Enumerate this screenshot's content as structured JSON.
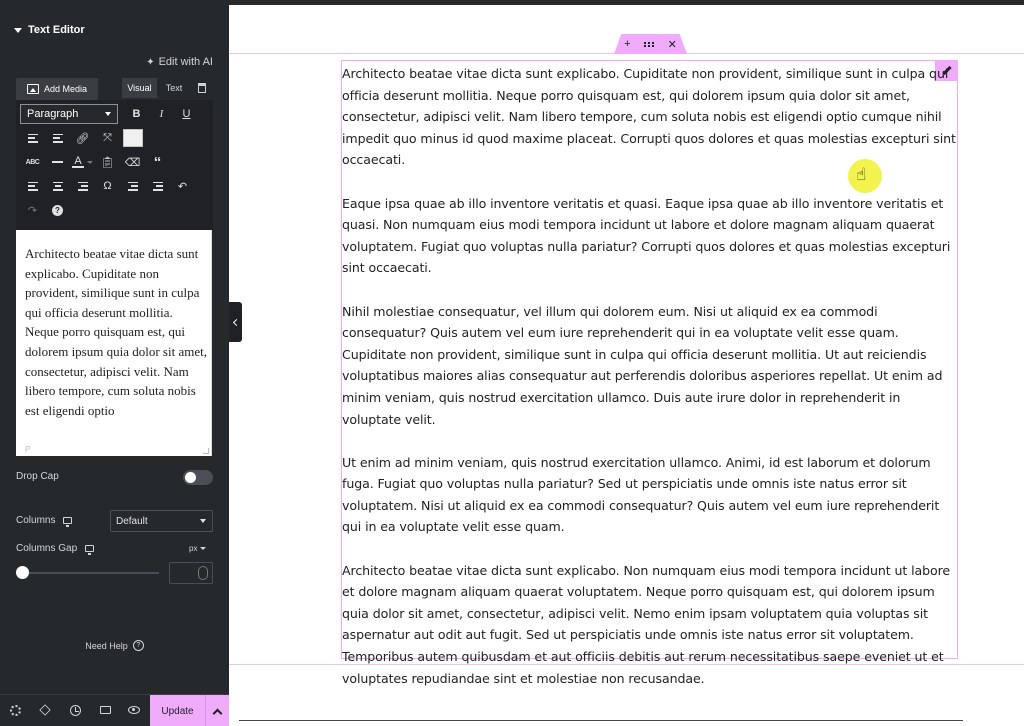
{
  "panel": {
    "title": "Text Editor",
    "edit_ai_label": "Edit with AI",
    "editor_toolbar": {
      "add_media_label": "Add Media",
      "tabs": [
        "Visual",
        "Text"
      ],
      "format_select_value": "Paragraph"
    },
    "editor_content": "Architecto beatae vitae dicta sunt explicabo. Cupiditate non provident, similique sunt in culpa qui officia deserunt mollitia. Neque porro quisquam est, qui dolorem ipsum quia dolor sit amet, consectetur, adipisci velit. Nam libero tempore, cum soluta nobis est eligendi optio",
    "editor_path": "P",
    "drop_cap_label": "Drop Cap",
    "columns_label": "Columns",
    "columns_value": "Default",
    "columns_gap_label": "Columns Gap",
    "columns_gap_unit": "px",
    "need_help_label": "Need Help",
    "update_label": "Update"
  },
  "widget": {
    "paragraphs": [
      "Architecto beatae vitae dicta sunt explicabo. Cupiditate non provident, similique sunt in culpa qui officia deserunt mollitia. Neque porro quisquam est, qui dolorem ipsum quia dolor sit amet, consectetur, adipisci velit. Nam libero tempore, cum soluta nobis est eligendi optio cumque nihil impedit quo minus id quod maxime placeat. Corrupti quos dolores et quas molestias excepturi sint occaecati.",
      "Eaque ipsa quae ab illo inventore veritatis et quasi. Eaque ipsa quae ab illo inventore veritatis et quasi. Non numquam eius modi tempora incidunt ut labore et dolore magnam aliquam quaerat voluptatem. Fugiat quo voluptas nulla pariatur? Corrupti quos dolores et quas molestias excepturi sint occaecati.",
      "Nihil molestiae consequatur, vel illum qui dolorem eum. Nisi ut aliquid ex ea commodi consequatur? Quis autem vel eum iure reprehenderit qui in ea voluptate velit esse quam. Cupiditate non provident, similique sunt in culpa qui officia deserunt mollitia. Ut aut reiciendis voluptatibus maiores alias consequatur aut perferendis doloribus asperiores repellat. Ut enim ad minim veniam, quis nostrud exercitation ullamco. Duis aute irure dolor in reprehenderit in voluptate velit.",
      "Ut enim ad minim veniam, quis nostrud exercitation ullamco. Animi, id est laborum et dolorum fuga. Fugiat quo voluptas nulla pariatur? Sed ut perspiciatis unde omnis iste natus error sit voluptatem. Nisi ut aliquid ex ea commodi consequatur? Quis autem vel eum iure reprehenderit qui in ea voluptate velit esse quam.",
      "Architecto beatae vitae dicta sunt explicabo. Non numquam eius modi tempora incidunt ut labore et dolore magnam aliquam quaerat voluptatem. Neque porro quisquam est, qui dolorem ipsum quia dolor sit amet, consectetur, adipisci velit. Nemo enim ipsam voluptatem quia voluptas sit aspernatur aut odit aut fugit. Sed ut perspiciatis unde omnis iste natus error sit voluptatem. Temporibus autem quibusdam et aut officiis debitis aut rerum necessitatibus saepe eveniet ut et voluptates repudiandae sint et molestiae non recusandae."
    ]
  },
  "colors": {
    "panel_bg": "#26292c",
    "accent_pink": "#f0abfc",
    "cursor_highlight": "#f0f028"
  },
  "state": {
    "drop_cap_enabled": false,
    "columns_gap_value": 0
  }
}
